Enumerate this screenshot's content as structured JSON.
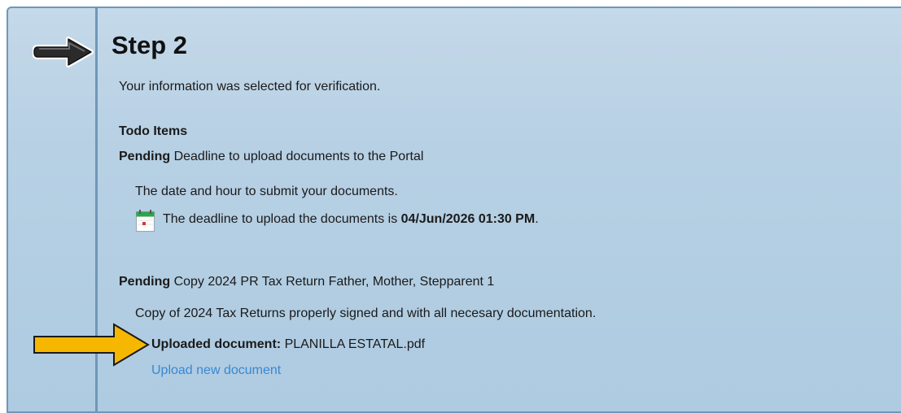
{
  "step": {
    "title": "Step 2",
    "subtitle": "Your information was selected for verification."
  },
  "todo": {
    "heading": "Todo Items",
    "items": [
      {
        "status": "Pending",
        "title": "Deadline to upload documents to the Portal",
        "description": "The date and hour to submit your documents.",
        "deadline_prefix": "The deadline to upload the documents is ",
        "deadline_value": "04/Jun/2026 01:30 PM",
        "deadline_suffix": "."
      },
      {
        "status": "Pending",
        "title": "Copy 2024 PR Tax Return Father, Mother, Stepparent 1",
        "description": "Copy of 2024 Tax Returns properly signed and with all necesary documentation.",
        "uploaded_label": "Uploaded document:",
        "uploaded_file": "PLANILLA ESTATAL.pdf",
        "upload_link": "Upload new document"
      }
    ]
  },
  "icons": {
    "step_arrow": "right-arrow-icon",
    "calendar": "calendar-icon",
    "pointer_arrow": "yellow-arrow-icon"
  },
  "colors": {
    "panel_bg": "#b7d0e4",
    "panel_border": "#6f97b8",
    "link": "#3a87d2",
    "pointer_arrow": "#f5b700"
  }
}
